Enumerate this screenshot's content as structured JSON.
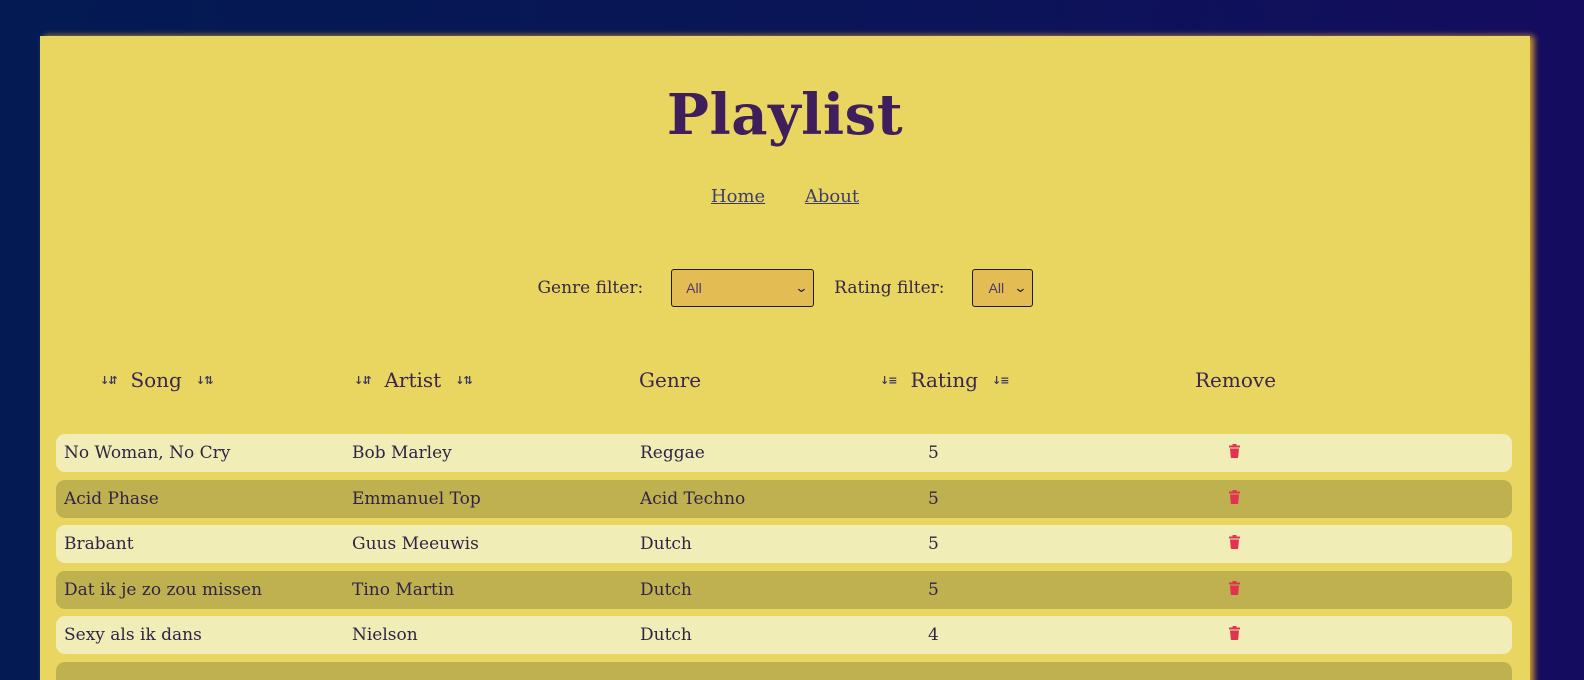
{
  "title": "Playlist",
  "nav": {
    "home": "Home",
    "about": "About"
  },
  "filters": {
    "genre_label": "Genre filter:",
    "genre_value": "All",
    "rating_label": "Rating filter:",
    "rating_value": "All"
  },
  "table": {
    "headers": {
      "song": "Song",
      "artist": "Artist",
      "genre": "Genre",
      "rating": "Rating",
      "remove": "Remove"
    },
    "rows": [
      {
        "song": "No Woman, No Cry",
        "artist": "Bob Marley",
        "genre": "Reggae",
        "rating": "5"
      },
      {
        "song": "Acid Phase",
        "artist": "Emmanuel Top",
        "genre": "Acid Techno",
        "rating": "5"
      },
      {
        "song": "Brabant",
        "artist": "Guus Meeuwis",
        "genre": "Dutch",
        "rating": "5"
      },
      {
        "song": "Dat ik je zo zou missen",
        "artist": "Tino Martin",
        "genre": "Dutch",
        "rating": "5"
      },
      {
        "song": "Sexy als ik dans",
        "artist": "Nielson",
        "genre": "Dutch",
        "rating": "4"
      },
      {
        "song": "",
        "artist": "",
        "genre": "",
        "rating": ""
      }
    ]
  },
  "colors": {
    "background": "#0b1458",
    "card": "#e9d660",
    "title": "#3e1f5c",
    "row_light": "#f1edb6",
    "row_dark": "#bfb050",
    "trash": "#e0334f"
  },
  "icons": {
    "sort_asc": "sort-ascending-icon",
    "sort_desc": "sort-descending-icon",
    "remove": "trash-icon"
  }
}
